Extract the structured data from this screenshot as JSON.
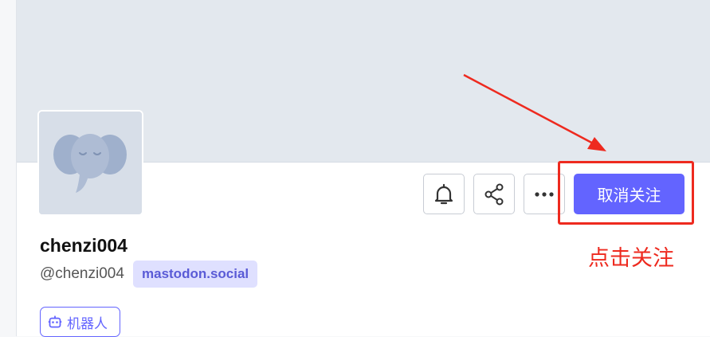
{
  "profile": {
    "display_name": "chenzi004",
    "username": "@chenzi004",
    "domain": "mastodon.social",
    "bot_label": "机器人"
  },
  "actions": {
    "notify_icon": "bell-icon",
    "share_icon": "share-icon",
    "more_icon": "more-horizontal-icon",
    "follow_button_label": "取消关注"
  },
  "annotation": {
    "label": "点击关注",
    "color": "#ee2a1f"
  },
  "colors": {
    "accent": "#6364ff",
    "banner": "#e3e8ee",
    "avatar_bg": "#d7dee8"
  }
}
